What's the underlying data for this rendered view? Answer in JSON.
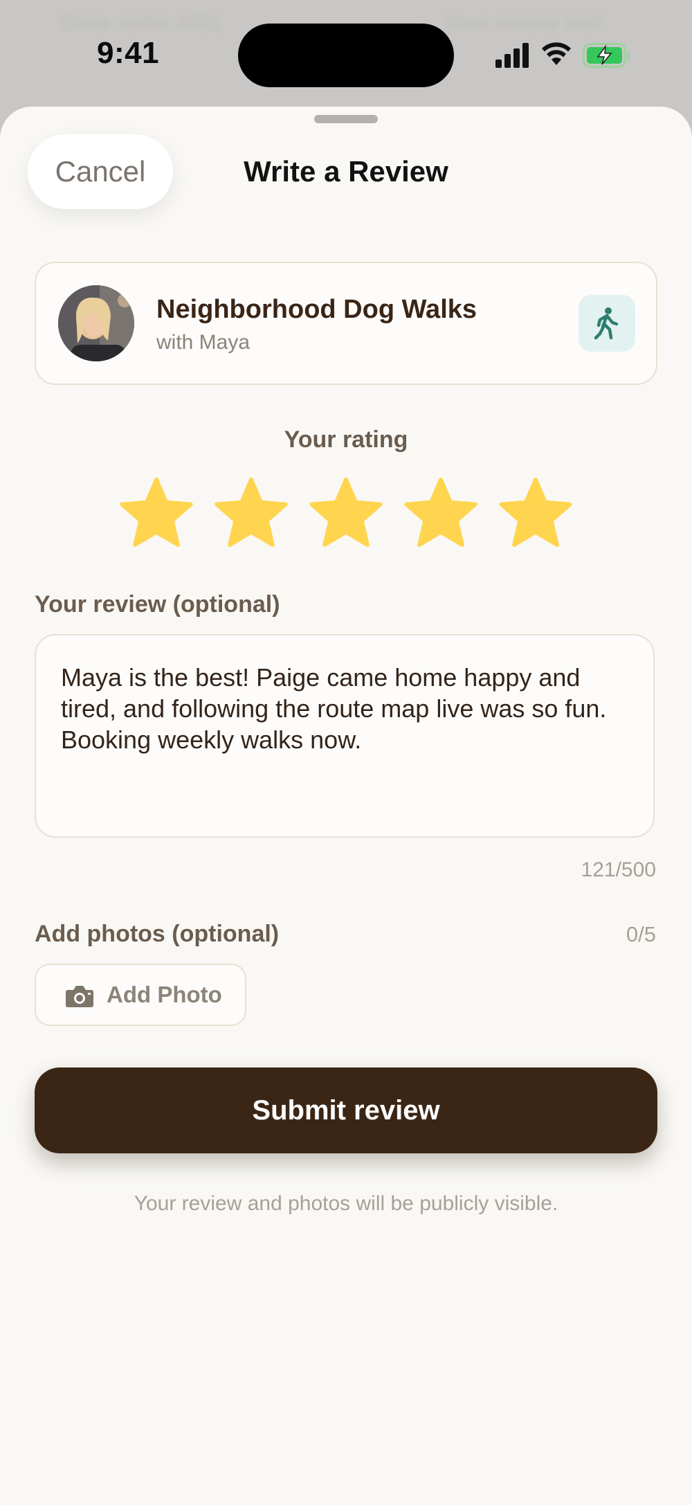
{
  "status_bar": {
    "time": "9:41",
    "background_text_left": "Code order #321",
    "background_text_right": "Your review text"
  },
  "sheet": {
    "title": "Write a Review",
    "cancel_label": "Cancel"
  },
  "service": {
    "name": "Neighborhood Dog Walks",
    "subtitle": "with Maya",
    "badge_icon": "walking-person-icon",
    "avatar_icon": "provider-avatar"
  },
  "rating": {
    "label": "Your rating",
    "value": 5,
    "max": 5,
    "star_color": "#FFD54F"
  },
  "review": {
    "label": "Your review (optional)",
    "text": "Maya is the best! Paige came home happy and tired, and following the route map live was so fun. Booking weekly walks now.",
    "char_count": "121/500"
  },
  "photos": {
    "label": "Add photos (optional)",
    "count": "0/5",
    "add_label": "Add Photo",
    "icon": "camera-icon"
  },
  "submit": {
    "label": "Submit review",
    "color": "#3B2616"
  },
  "disclaimer": "Your review and photos will be publicly visible."
}
